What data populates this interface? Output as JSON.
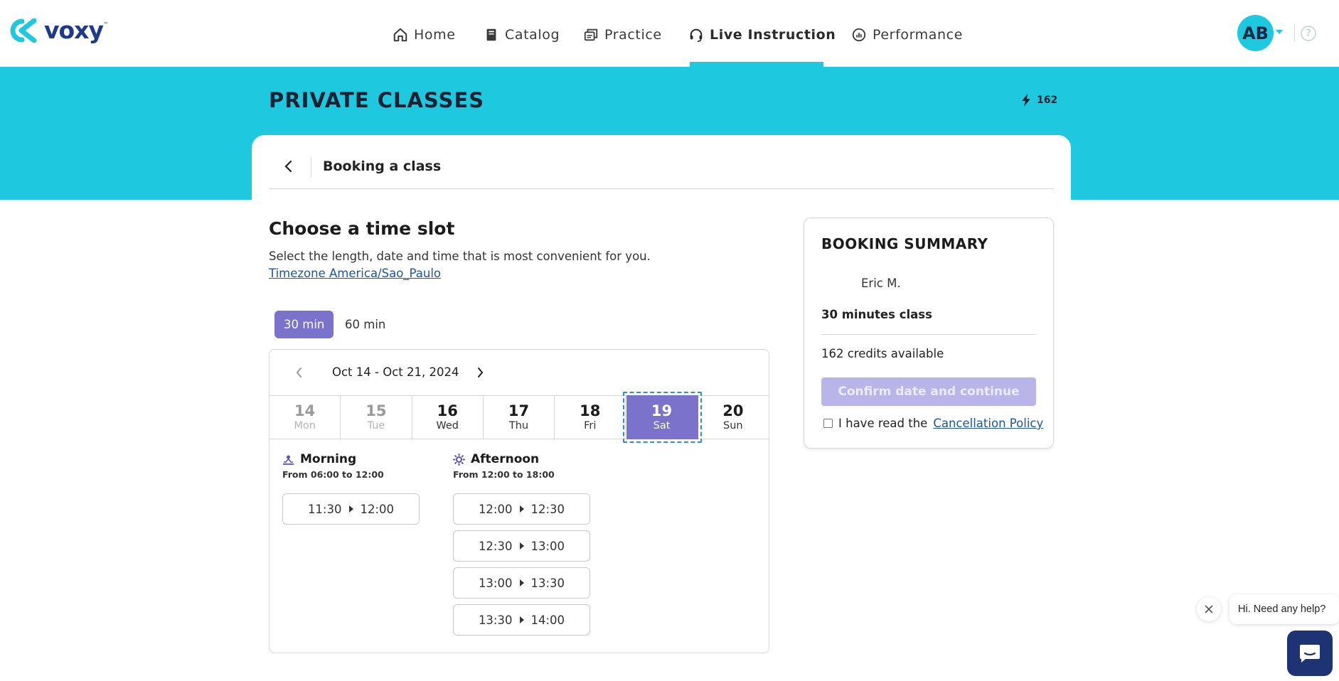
{
  "brand": {
    "name": "voxy",
    "tm": "™"
  },
  "nav": {
    "items": [
      {
        "label": "Home",
        "icon": "home-icon"
      },
      {
        "label": "Catalog",
        "icon": "book-icon"
      },
      {
        "label": "Practice",
        "icon": "practice-icon"
      },
      {
        "label": "Live Instruction",
        "icon": "headset-icon",
        "active": true
      },
      {
        "label": "Performance",
        "icon": "gauge-icon"
      }
    ],
    "avatar_initials": "AB",
    "help": "?"
  },
  "header": {
    "title": "PRIVATE CLASSES",
    "credits": "162"
  },
  "booking": {
    "header_title": "Booking a class",
    "section_title": "Choose a time slot",
    "description": "Select the length, date and time that is most convenient for you.",
    "timezone_link": "Timezone America/Sao_Paulo",
    "lengths": [
      {
        "label": "30 min",
        "selected": true
      },
      {
        "label": "60 min",
        "selected": false
      }
    ],
    "calendar": {
      "range": "Oct 14 - Oct 21, 2024",
      "days": [
        {
          "num": "14",
          "name": "Mon",
          "state": "disabled"
        },
        {
          "num": "15",
          "name": "Tue",
          "state": "disabled"
        },
        {
          "num": "16",
          "name": "Wed",
          "state": "available"
        },
        {
          "num": "17",
          "name": "Thu",
          "state": "available"
        },
        {
          "num": "18",
          "name": "Fri",
          "state": "available"
        },
        {
          "num": "19",
          "name": "Sat",
          "state": "selected"
        },
        {
          "num": "20",
          "name": "Sun",
          "state": "available"
        }
      ]
    },
    "morning": {
      "title": "Morning",
      "subtitle": "From 06:00 to 12:00",
      "slots": [
        {
          "start": "11:30",
          "end": "12:00"
        }
      ]
    },
    "afternoon": {
      "title": "Afternoon",
      "subtitle": "From 12:00 to 18:00",
      "slots": [
        {
          "start": "12:00",
          "end": "12:30"
        },
        {
          "start": "12:30",
          "end": "13:00"
        },
        {
          "start": "13:00",
          "end": "13:30"
        },
        {
          "start": "13:30",
          "end": "14:00"
        }
      ]
    }
  },
  "summary": {
    "title": "BOOKING SUMMARY",
    "teacher": "Eric M.",
    "class_length": "30 minutes class",
    "credits_available": "162 credits available",
    "confirm_label": "Confirm date and continue",
    "policy_text": "I have read the",
    "policy_link": "Cancellation Policy"
  },
  "chat": {
    "greeting": "Hi. Need any help?"
  },
  "colors": {
    "brand_teal": "#1ec8de",
    "brand_navy": "#1e3a8a",
    "accent_purple": "#7b72cc",
    "disabled_purple": "#b9b5e8",
    "link_blue": "#1a55a8",
    "chat_navy": "#1e3373"
  }
}
